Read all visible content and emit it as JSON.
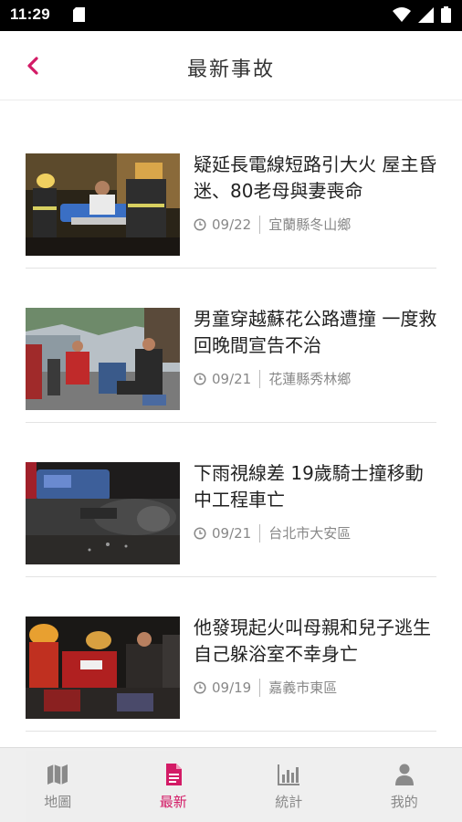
{
  "status_bar": {
    "time": "11:29",
    "icons": [
      "sd-card-icon",
      "wifi-icon",
      "cell-signal-icon",
      "battery-icon"
    ]
  },
  "header": {
    "title": "最新事故",
    "back_icon": "chevron-left-icon",
    "accent_color": "#d31b66"
  },
  "news": [
    {
      "title": "疑延長電線短路引大火 屋主昏迷、80老母與妻喪命",
      "date": "09/22",
      "location": "宜蘭縣冬山鄉"
    },
    {
      "title": "男童穿越蘇花公路遭撞 一度救回晚間宣告不治",
      "date": "09/21",
      "location": "花蓮縣秀林鄉"
    },
    {
      "title": "下雨視線差 19歲騎士撞移動中工程車亡",
      "date": "09/21",
      "location": "台北市大安區"
    },
    {
      "title": "他發現起火叫母親和兒子逃生 自己躲浴室不幸身亡",
      "date": "09/19",
      "location": "嘉義市東區"
    }
  ],
  "bottom_nav": {
    "tabs": [
      {
        "label": "地圖",
        "icon": "map-icon",
        "active": false
      },
      {
        "label": "最新",
        "icon": "document-icon",
        "active": true
      },
      {
        "label": "統計",
        "icon": "bar-chart-icon",
        "active": false
      },
      {
        "label": "我的",
        "icon": "user-icon",
        "active": false
      }
    ]
  }
}
